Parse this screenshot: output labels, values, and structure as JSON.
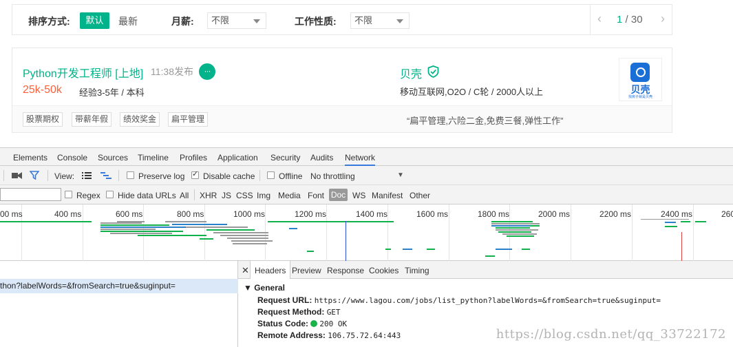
{
  "site": {
    "filter": {
      "sort_label": "排序方式:",
      "sort_default": "默认",
      "sort_new": "最新",
      "salary_label": "月薪:",
      "salary_value": "不限",
      "nature_label": "工作性质:",
      "nature_value": "不限",
      "pager": {
        "current": "1",
        "separator": " / ",
        "total": "30",
        "prev": "‹",
        "next": "›"
      }
    },
    "job": {
      "title": "Python开发工程师 [上地]",
      "time": "11:38发布",
      "chat_icon": "···",
      "salary": "25k-50k",
      "requirement": "经验3-5年 / 本科",
      "company": "贝壳",
      "industry": "移动互联网,O2O / C轮 / 2000人以上",
      "logo_text": "贝壳",
      "logo_sub": "找房子就是贝壳",
      "tags": [
        "股票期权",
        "带薪年假",
        "绩效奖金",
        "扁平管理"
      ],
      "slogan": "“扁平管理,六险二金,免费三餐,弹性工作”",
      "accent": "#00b38a",
      "salary_color": "#fd5f39"
    }
  },
  "devtools": {
    "tabs": [
      "Elements",
      "Console",
      "Sources",
      "Timeline",
      "Profiles",
      "Application",
      "Security",
      "Audits",
      "Network"
    ],
    "active_tab": "Network",
    "toolbar": {
      "view_label": "View:",
      "preserve_log": "Preserve log",
      "preserve_log_checked": false,
      "disable_cache": "Disable cache",
      "disable_cache_checked": true,
      "offline": "Offline",
      "offline_checked": false,
      "throttling": "No throttling"
    },
    "filter": {
      "regex": "Regex",
      "hide_data_urls": "Hide data URLs",
      "types": [
        "All",
        "XHR",
        "JS",
        "CSS",
        "Img",
        "Media",
        "Font",
        "Doc",
        "WS",
        "Manifest",
        "Other"
      ],
      "active_type": "Doc"
    },
    "overview_ticks": [
      "00 ms",
      "400 ms",
      "600 ms",
      "800 ms",
      "1000 ms",
      "1200 ms",
      "1400 ms",
      "1600 ms",
      "1800 ms",
      "2000 ms",
      "2200 ms",
      "2400 ms",
      "260"
    ],
    "request_row": "thon?labelWords=&fromSearch=true&suginput=",
    "detail_tabs": [
      "Headers",
      "Preview",
      "Response",
      "Cookies",
      "Timing"
    ],
    "active_detail_tab": "Headers",
    "general": {
      "heading": "▼ General",
      "request_url_label": "Request URL:",
      "request_url": "https://www.lagou.com/jobs/list_python?labelWords=&fromSearch=true&suginput=",
      "method_label": "Request Method:",
      "method": "GET",
      "status_label": "Status Code:",
      "status": "200 OK",
      "status_color": "#1ab34a",
      "remote_label": "Remote Address:",
      "remote": "106.75.72.64:443"
    }
  },
  "watermark": "https://blog.csdn.net/qq_33722172"
}
